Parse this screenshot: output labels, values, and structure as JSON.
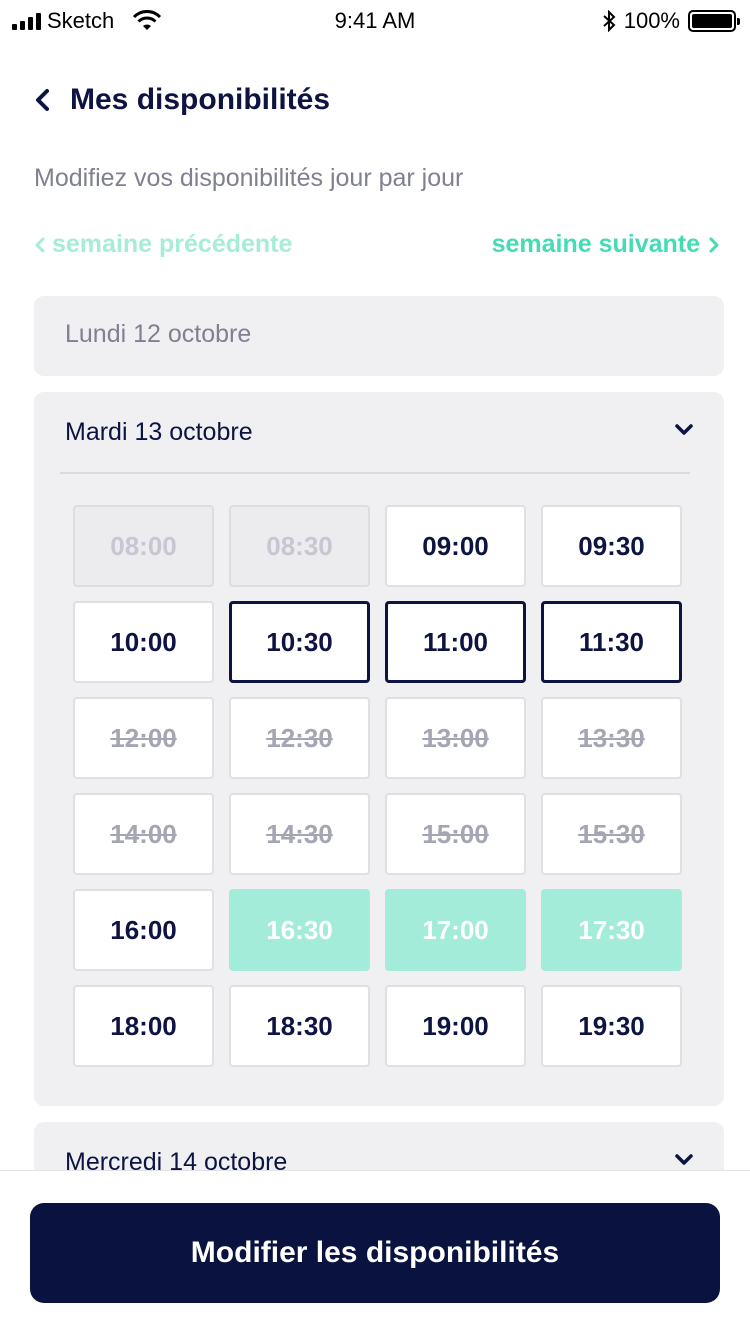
{
  "status_bar": {
    "carrier": "Sketch",
    "time": "9:41 AM",
    "battery": "100%"
  },
  "header": {
    "title": "Mes disponibilités",
    "subtitle": "Modifiez vos disponibilités jour par jour"
  },
  "week_nav": {
    "previous": "semaine précédente",
    "next": "semaine suivante"
  },
  "days": [
    {
      "label": "Lundi 12 octobre",
      "expanded": false
    },
    {
      "label": "Mardi 13 octobre",
      "expanded": true,
      "slots": [
        {
          "time": "08:00",
          "state": "past"
        },
        {
          "time": "08:30",
          "state": "past"
        },
        {
          "time": "09:00",
          "state": "available"
        },
        {
          "time": "09:30",
          "state": "available"
        },
        {
          "time": "10:00",
          "state": "available"
        },
        {
          "time": "10:30",
          "state": "selected"
        },
        {
          "time": "11:00",
          "state": "selected"
        },
        {
          "time": "11:30",
          "state": "selected"
        },
        {
          "time": "12:00",
          "state": "booked"
        },
        {
          "time": "12:30",
          "state": "booked"
        },
        {
          "time": "13:00",
          "state": "booked"
        },
        {
          "time": "13:30",
          "state": "booked"
        },
        {
          "time": "14:00",
          "state": "booked"
        },
        {
          "time": "14:30",
          "state": "booked"
        },
        {
          "time": "15:00",
          "state": "booked"
        },
        {
          "time": "15:30",
          "state": "booked"
        },
        {
          "time": "16:00",
          "state": "available"
        },
        {
          "time": "16:30",
          "state": "highlight"
        },
        {
          "time": "17:00",
          "state": "highlight"
        },
        {
          "time": "17:30",
          "state": "highlight"
        },
        {
          "time": "18:00",
          "state": "available"
        },
        {
          "time": "18:30",
          "state": "available"
        },
        {
          "time": "19:00",
          "state": "available"
        },
        {
          "time": "19:30",
          "state": "available"
        }
      ]
    },
    {
      "label": "Mercredi 14 octobre",
      "expanded": false
    }
  ],
  "cta": {
    "label": "Modifier les disponibilités"
  },
  "colors": {
    "navy": "#0a1340",
    "mint": "#45dcb5",
    "mint_light": "#a3ecd9",
    "card_bg": "#f0f0f2",
    "muted": "#7f8190"
  },
  "icons": {
    "back": "chevron-left-icon",
    "expand": "chevron-down-icon",
    "prev": "chevron-left-icon",
    "next": "chevron-right-icon"
  }
}
